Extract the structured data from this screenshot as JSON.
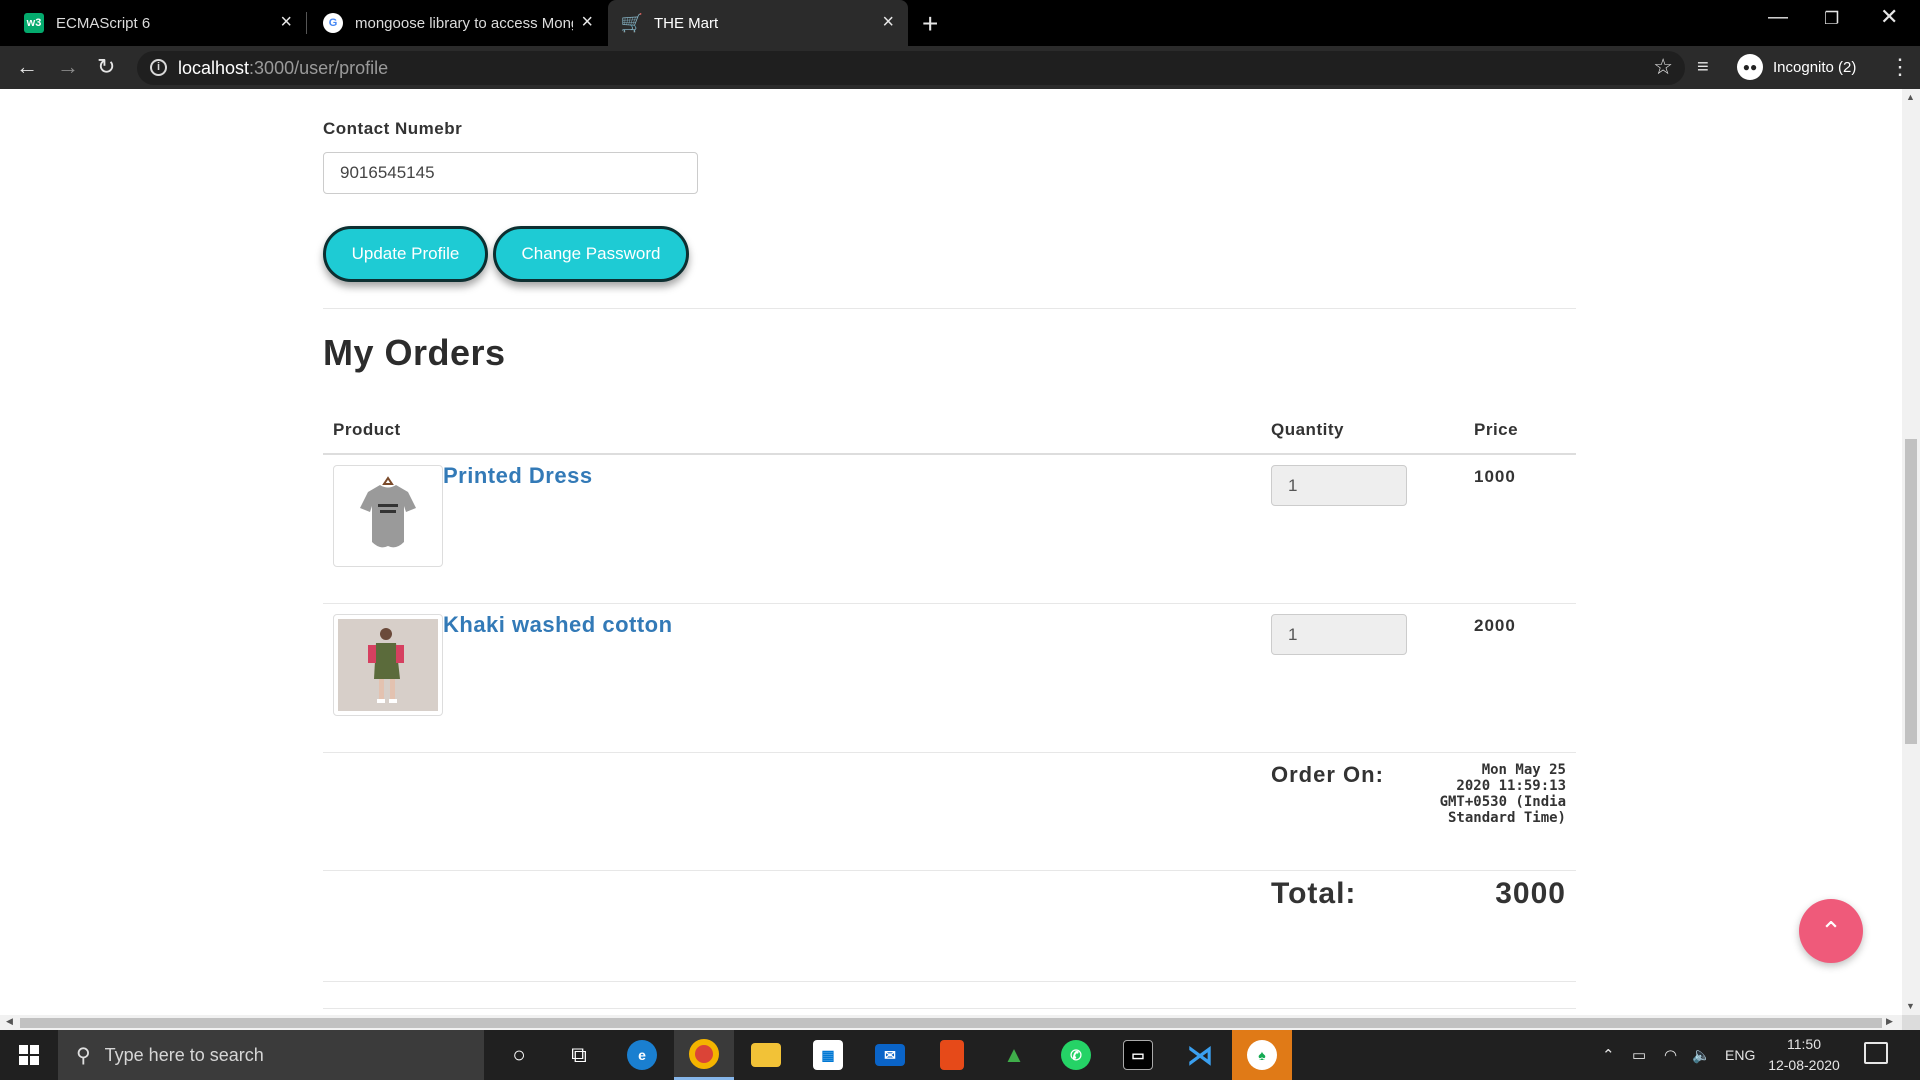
{
  "browser": {
    "tabs": [
      {
        "title": "ECMAScript 6",
        "favicon": "w3schools-icon",
        "active": false
      },
      {
        "title": "mongoose library to access MongoDB",
        "favicon": "google-icon",
        "active": false
      },
      {
        "title": "THE Mart",
        "favicon": "cart-icon",
        "active": true
      }
    ],
    "url_host": "localhost",
    "url_path": ":3000/user/profile",
    "profile_label": "Incognito (2)"
  },
  "profile": {
    "contact_label": "Contact Numebr",
    "contact_value": "9016545145",
    "update_button": "Update Profile",
    "password_button": "Change Password"
  },
  "orders": {
    "title": "My Orders",
    "headers": {
      "product": "Product",
      "quantity": "Quantity",
      "price": "Price"
    },
    "items": [
      {
        "name": "Printed Dress",
        "quantity": "1",
        "price": "1000"
      },
      {
        "name": "Khaki washed cotton",
        "quantity": "1",
        "price": "2000"
      }
    ],
    "order_on_label": "Order On:",
    "order_date_lines": [
      "Mon May 25",
      "2020 11:59:13",
      "GMT+0530 (India",
      "Standard Time)"
    ],
    "total_label": "Total:",
    "total_value": "3000"
  },
  "taskbar": {
    "search_placeholder": "Type here to search",
    "language": "ENG",
    "time": "11:50",
    "date": "12-08-2020"
  },
  "colors": {
    "accent_button": "#1ecbd4",
    "link": "#337ab7",
    "scroll_top": "#ef5a7a"
  }
}
